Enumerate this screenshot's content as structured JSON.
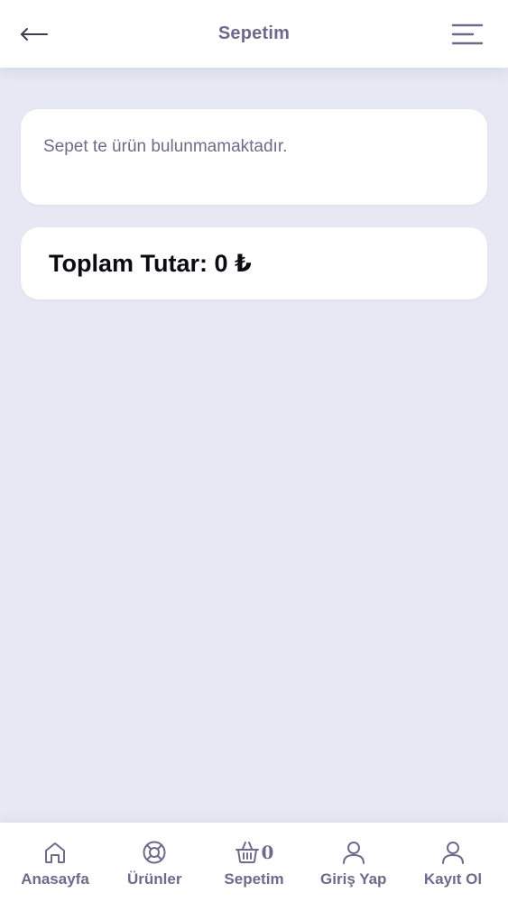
{
  "header": {
    "title": "Sepetim"
  },
  "cart": {
    "empty_message": "Sepet te ürün bulunmamaktadır.",
    "total_label": "Toplam Tutar: 0 ₺"
  },
  "bottom_nav": {
    "items": [
      {
        "label": "Anasayfa",
        "icon": "home-icon"
      },
      {
        "label": "Ürünler",
        "icon": "lifebuoy-icon"
      },
      {
        "label": "Sepetim",
        "icon": "basket-icon"
      },
      {
        "label": "Giriş Yap",
        "icon": "user-icon"
      },
      {
        "label": "Kayıt Ol",
        "icon": "user-icon"
      }
    ],
    "cart_count": "0"
  },
  "colors": {
    "background": "#e6e8f4",
    "accent_text": "#6e6a8c",
    "card": "#ffffff"
  }
}
